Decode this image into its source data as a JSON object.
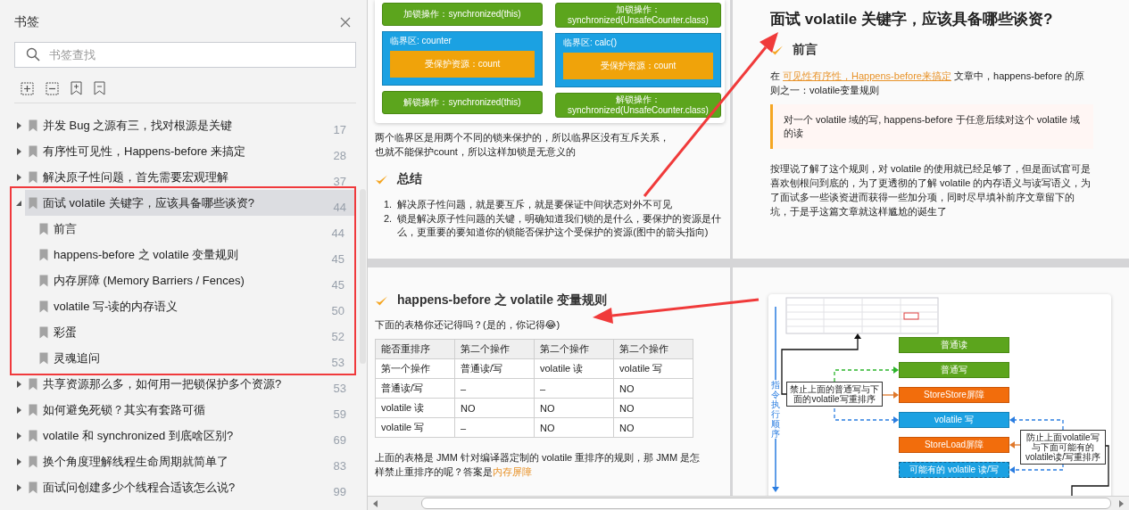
{
  "sidebar": {
    "title": "书签",
    "search": {
      "placeholder": "书签查找"
    },
    "bookmarks": [
      {
        "label": "并发 Bug 之源有三，找对根源是关键",
        "page": "17",
        "expanded": false,
        "selected": false
      },
      {
        "label": "有序性可见性，Happens-before 来搞定",
        "page": "28",
        "expanded": false,
        "selected": false
      },
      {
        "label": "解决原子性问题，首先需要宏观理解",
        "page": "37",
        "expanded": false,
        "selected": false
      },
      {
        "label": "面试 volatile 关键字，应该具备哪些谈资?",
        "page": "44",
        "expanded": true,
        "selected": true,
        "children": [
          {
            "label": "前言",
            "page": "44",
            "selected": false
          },
          {
            "label": "happens-before 之 volatile 变量规则",
            "page": "45",
            "selected": false
          },
          {
            "label": "内存屏障 (Memory Barriers / Fences)",
            "page": "45",
            "selected": false
          },
          {
            "label": "volatile 写-读的内存语义",
            "page": "50",
            "selected": false
          },
          {
            "label": "彩蛋",
            "page": "52",
            "selected": false
          },
          {
            "label": "灵魂追问",
            "page": "53",
            "selected": false
          }
        ]
      },
      {
        "label": "共享资源那么多，如何用一把锁保护多个资源?",
        "page": "53",
        "expanded": false,
        "selected": false
      },
      {
        "label": "如何避免死锁？其实有套路可循",
        "page": "59",
        "expanded": false,
        "selected": false
      },
      {
        "label": "volatile 和 synchronized 到底啥区别?",
        "page": "69",
        "expanded": false,
        "selected": false
      },
      {
        "label": "换个角度理解线程生命周期就简单了",
        "page": "83",
        "expanded": false,
        "selected": false
      },
      {
        "label": "面试问创建多少个线程合适该怎么说?",
        "page": "99",
        "expanded": false,
        "selected": false
      }
    ]
  },
  "pages": [
    {
      "blocks": [
        {
          "kind": "lock_diagram",
          "columns": [
            {
              "lock": "加锁操作：synchronized(this)",
              "area": "临界区: counter",
              "resource": "受保护资源：count",
              "unlock": "解锁操作：synchronized(this)"
            },
            {
              "lock": "加锁操作：synchronized(UnsafeCounter.class)",
              "area": "临界区: calc()",
              "resource": "受保护资源：count",
              "unlock": "解锁操作：synchronized(UnsafeCounter.class)"
            }
          ]
        },
        {
          "kind": "paragraph",
          "parts": [
            {
              "text": "两个临界区是用两个不同的锁来保护的，所以临界区没有互斥关系，也就不能保护count，所以这样加锁是无意义的",
              "kind": "plain"
            }
          ]
        },
        {
          "kind": "heading",
          "text": "总结"
        },
        {
          "kind": "ordered_list",
          "items": [
            {
              "marker": "1.",
              "text": "解决原子性问题，就是要互斥，就是要保证中间状态对外不可见"
            },
            {
              "marker": "2.",
              "text": "锁是解决原子性问题的关键，明确知道我们锁的是什么，要保护的资源是什么，更重要的要知道你的锁能否保护这个受保护的资源(图中的箭头指向)"
            }
          ]
        }
      ]
    },
    {
      "blocks": [
        {
          "kind": "title",
          "text": "面试 volatile 关键字，应该具备哪些谈资?"
        },
        {
          "kind": "heading",
          "text": "前言"
        },
        {
          "kind": "paragraph",
          "parts": [
            {
              "text": "在 ",
              "kind": "plain"
            },
            {
              "text": "可见性有序性，Happens-before来搞定",
              "kind": "link"
            },
            {
              "text": " 文章中，happens-before 的原则之一：volatile变量规则",
              "kind": "plain"
            }
          ]
        },
        {
          "kind": "quote",
          "text": "对一个 volatile 域的写, happens-before 于任意后续对这个 volatile 域的读"
        },
        {
          "kind": "paragraph",
          "parts": [
            {
              "text": "按理说了解了这个规则，对 volatile 的使用就已经足够了，但是面试官可是喜欢刨根问到底的，为了更透彻的了解 volatile 的内存语义与读写语义，为了面试多一些谈资进而获得一些加分项，同时尽早填补前序文章留下的坑，于是乎这篇文章就这样尴尬的诞生了",
              "kind": "plain"
            }
          ]
        }
      ]
    },
    {
      "blocks": [
        {
          "kind": "heading",
          "text": "happens-before 之 volatile 变量规则"
        },
        {
          "kind": "paragraph",
          "parts": [
            {
              "text": "下面的表格你还记得吗？(是的，你记得😂)",
              "kind": "plain"
            }
          ]
        },
        {
          "kind": "table",
          "header": [
            "能否重排序",
            "第二个操作",
            "第二个操作",
            "第二个操作"
          ],
          "rows": [
            [
              "第一个操作",
              "普通读/写",
              "volatile 读",
              "volatile 写"
            ],
            [
              "普通读/写",
              "–",
              "–",
              "NO"
            ],
            [
              "volatile 读",
              "NO",
              "NO",
              "NO"
            ],
            [
              "volatile 写",
              "–",
              "NO",
              "NO"
            ]
          ]
        },
        {
          "kind": "paragraph",
          "parts": [
            {
              "text": "上面的表格是 JMM 针对编译器定制的 volatile 重排序的规则，那 JMM 是怎样禁止重排序的呢？答案是",
              "kind": "plain"
            },
            {
              "text": "内存屏障",
              "kind": "highlight"
            }
          ]
        }
      ]
    },
    {
      "blocks": [
        {
          "kind": "barrier_diagram",
          "axis_label": "指令执行顺序",
          "steps": [
            {
              "label": "普通读",
              "kind": "normal"
            },
            {
              "label": "普通写",
              "kind": "normal"
            },
            {
              "label": "StoreStore屏障",
              "kind": "barrier"
            },
            {
              "label": "volatile 写",
              "kind": "volatile"
            },
            {
              "label": "StoreLoad屏障",
              "kind": "barrier"
            },
            {
              "label": "可能有的 volatile 读/写",
              "kind": "optional"
            }
          ],
          "notes": [
            "禁止上面的普通写与下面的volatile写重排序",
            "防止上面volatile写与下面可能有的volatile读/写重排序"
          ]
        }
      ]
    }
  ]
}
